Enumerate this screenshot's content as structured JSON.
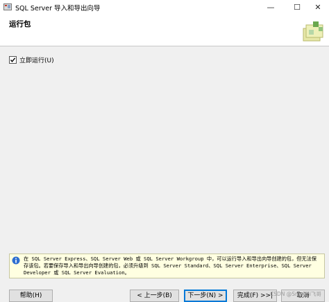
{
  "window": {
    "title": "SQL Server 导入和导出向导",
    "minimize_glyph": "—",
    "maximize_glyph": "☐",
    "close_glyph": "✕"
  },
  "header": {
    "title": "运行包"
  },
  "options": {
    "run_immediately_label": "立即运行(U)",
    "run_immediately_checked": true
  },
  "info": {
    "icon": "info-icon",
    "text": "在 SQL Server Express、SQL Server Web 或 SQL Server Workgroup 中，可以运行导入和导出向导创建的包，但无法保存该包。若要保存导入和导出向导创建的包，必须升级到 SQL Server Standard、SQL Server Enterprise、SQL Server Developer 或 SQL Server Evaluation。"
  },
  "buttons": {
    "help": "帮助(H)",
    "back": "< 上一步(B)",
    "next": "下一步(N) >",
    "finish": "完成(F) >>|",
    "cancel": "取消"
  },
  "watermark": "CSDN @Smallhi飞哥"
}
